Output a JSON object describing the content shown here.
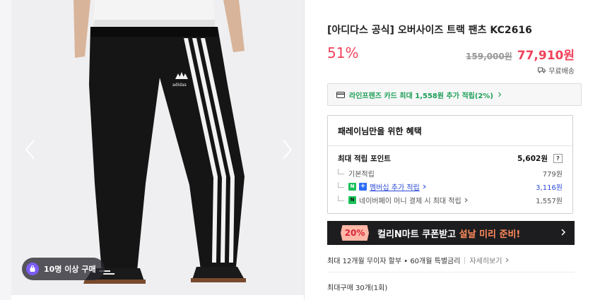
{
  "product": {
    "title": "[아디다스 공식] 오버사이즈 트랙 팬츠 KC2616",
    "discount": "51%",
    "original_price": "159,000원",
    "sale_price": "77,910원",
    "shipping": "무료배송"
  },
  "card_promo": "라인프렌즈 카드 최대 1,558원 추가 적립(2%)",
  "benefits": {
    "title": "패레이님만을 위한 혜택",
    "max_points_label": "최대 적립 포인트",
    "max_points_value": "5,602원",
    "help": "?",
    "rows": [
      {
        "label": "기본적립",
        "value": "779원"
      },
      {
        "label": "멤버십 추가 적립",
        "value": "3,116원"
      },
      {
        "label": "네이버페이 머니 결제 시 최대 적립",
        "value": "1,557원"
      }
    ]
  },
  "banner": {
    "percent": "20%",
    "text": "컬리N마트 쿠폰받고 ",
    "highlight": "설날 미리 준비!"
  },
  "installment": {
    "text": "최대 12개월 무이자 할부 • 60개월 특별금리",
    "more": "자세히보기"
  },
  "max_purchase": "최대구매 30개(1회)",
  "image": {
    "badge": "10명 이상 구매",
    "brand_text": "adidas"
  },
  "colors": {
    "accent": "#f1425b",
    "naver_green": "#19c15a",
    "banner_bg": "#1d1d1f"
  }
}
